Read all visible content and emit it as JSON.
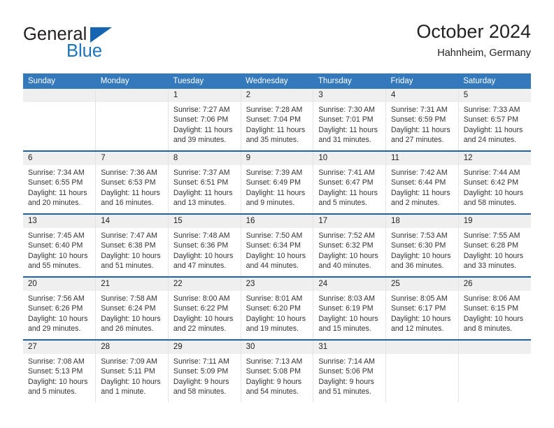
{
  "brand": {
    "name_top": "General",
    "name_bottom": "Blue",
    "triangle_color": "#1665b0",
    "text_top_color": "#231f20",
    "text_bottom_color": "#1c75bc"
  },
  "header": {
    "title": "October 2024",
    "subtitle": "Hahnheim, Germany"
  },
  "theme": {
    "header_row_bg": "#3579bd",
    "header_row_text": "#ffffff",
    "row_separator": "#1f62ab",
    "daynum_band_bg": "#efefef",
    "cell_divider": "#e3e3e3",
    "body_text": "#333333"
  },
  "weekdays": [
    "Sunday",
    "Monday",
    "Tuesday",
    "Wednesday",
    "Thursday",
    "Friday",
    "Saturday"
  ],
  "weeks": [
    [
      {
        "day": "",
        "lines": []
      },
      {
        "day": "",
        "lines": []
      },
      {
        "day": "1",
        "lines": [
          "Sunrise: 7:27 AM",
          "Sunset: 7:06 PM",
          "Daylight: 11 hours",
          "and 39 minutes."
        ]
      },
      {
        "day": "2",
        "lines": [
          "Sunrise: 7:28 AM",
          "Sunset: 7:04 PM",
          "Daylight: 11 hours",
          "and 35 minutes."
        ]
      },
      {
        "day": "3",
        "lines": [
          "Sunrise: 7:30 AM",
          "Sunset: 7:01 PM",
          "Daylight: 11 hours",
          "and 31 minutes."
        ]
      },
      {
        "day": "4",
        "lines": [
          "Sunrise: 7:31 AM",
          "Sunset: 6:59 PM",
          "Daylight: 11 hours",
          "and 27 minutes."
        ]
      },
      {
        "day": "5",
        "lines": [
          "Sunrise: 7:33 AM",
          "Sunset: 6:57 PM",
          "Daylight: 11 hours",
          "and 24 minutes."
        ]
      }
    ],
    [
      {
        "day": "6",
        "lines": [
          "Sunrise: 7:34 AM",
          "Sunset: 6:55 PM",
          "Daylight: 11 hours",
          "and 20 minutes."
        ]
      },
      {
        "day": "7",
        "lines": [
          "Sunrise: 7:36 AM",
          "Sunset: 6:53 PM",
          "Daylight: 11 hours",
          "and 16 minutes."
        ]
      },
      {
        "day": "8",
        "lines": [
          "Sunrise: 7:37 AM",
          "Sunset: 6:51 PM",
          "Daylight: 11 hours",
          "and 13 minutes."
        ]
      },
      {
        "day": "9",
        "lines": [
          "Sunrise: 7:39 AM",
          "Sunset: 6:49 PM",
          "Daylight: 11 hours",
          "and 9 minutes."
        ]
      },
      {
        "day": "10",
        "lines": [
          "Sunrise: 7:41 AM",
          "Sunset: 6:47 PM",
          "Daylight: 11 hours",
          "and 5 minutes."
        ]
      },
      {
        "day": "11",
        "lines": [
          "Sunrise: 7:42 AM",
          "Sunset: 6:44 PM",
          "Daylight: 11 hours",
          "and 2 minutes."
        ]
      },
      {
        "day": "12",
        "lines": [
          "Sunrise: 7:44 AM",
          "Sunset: 6:42 PM",
          "Daylight: 10 hours",
          "and 58 minutes."
        ]
      }
    ],
    [
      {
        "day": "13",
        "lines": [
          "Sunrise: 7:45 AM",
          "Sunset: 6:40 PM",
          "Daylight: 10 hours",
          "and 55 minutes."
        ]
      },
      {
        "day": "14",
        "lines": [
          "Sunrise: 7:47 AM",
          "Sunset: 6:38 PM",
          "Daylight: 10 hours",
          "and 51 minutes."
        ]
      },
      {
        "day": "15",
        "lines": [
          "Sunrise: 7:48 AM",
          "Sunset: 6:36 PM",
          "Daylight: 10 hours",
          "and 47 minutes."
        ]
      },
      {
        "day": "16",
        "lines": [
          "Sunrise: 7:50 AM",
          "Sunset: 6:34 PM",
          "Daylight: 10 hours",
          "and 44 minutes."
        ]
      },
      {
        "day": "17",
        "lines": [
          "Sunrise: 7:52 AM",
          "Sunset: 6:32 PM",
          "Daylight: 10 hours",
          "and 40 minutes."
        ]
      },
      {
        "day": "18",
        "lines": [
          "Sunrise: 7:53 AM",
          "Sunset: 6:30 PM",
          "Daylight: 10 hours",
          "and 36 minutes."
        ]
      },
      {
        "day": "19",
        "lines": [
          "Sunrise: 7:55 AM",
          "Sunset: 6:28 PM",
          "Daylight: 10 hours",
          "and 33 minutes."
        ]
      }
    ],
    [
      {
        "day": "20",
        "lines": [
          "Sunrise: 7:56 AM",
          "Sunset: 6:26 PM",
          "Daylight: 10 hours",
          "and 29 minutes."
        ]
      },
      {
        "day": "21",
        "lines": [
          "Sunrise: 7:58 AM",
          "Sunset: 6:24 PM",
          "Daylight: 10 hours",
          "and 26 minutes."
        ]
      },
      {
        "day": "22",
        "lines": [
          "Sunrise: 8:00 AM",
          "Sunset: 6:22 PM",
          "Daylight: 10 hours",
          "and 22 minutes."
        ]
      },
      {
        "day": "23",
        "lines": [
          "Sunrise: 8:01 AM",
          "Sunset: 6:20 PM",
          "Daylight: 10 hours",
          "and 19 minutes."
        ]
      },
      {
        "day": "24",
        "lines": [
          "Sunrise: 8:03 AM",
          "Sunset: 6:19 PM",
          "Daylight: 10 hours",
          "and 15 minutes."
        ]
      },
      {
        "day": "25",
        "lines": [
          "Sunrise: 8:05 AM",
          "Sunset: 6:17 PM",
          "Daylight: 10 hours",
          "and 12 minutes."
        ]
      },
      {
        "day": "26",
        "lines": [
          "Sunrise: 8:06 AM",
          "Sunset: 6:15 PM",
          "Daylight: 10 hours",
          "and 8 minutes."
        ]
      }
    ],
    [
      {
        "day": "27",
        "lines": [
          "Sunrise: 7:08 AM",
          "Sunset: 5:13 PM",
          "Daylight: 10 hours",
          "and 5 minutes."
        ]
      },
      {
        "day": "28",
        "lines": [
          "Sunrise: 7:09 AM",
          "Sunset: 5:11 PM",
          "Daylight: 10 hours",
          "and 1 minute."
        ]
      },
      {
        "day": "29",
        "lines": [
          "Sunrise: 7:11 AM",
          "Sunset: 5:09 PM",
          "Daylight: 9 hours",
          "and 58 minutes."
        ]
      },
      {
        "day": "30",
        "lines": [
          "Sunrise: 7:13 AM",
          "Sunset: 5:08 PM",
          "Daylight: 9 hours",
          "and 54 minutes."
        ]
      },
      {
        "day": "31",
        "lines": [
          "Sunrise: 7:14 AM",
          "Sunset: 5:06 PM",
          "Daylight: 9 hours",
          "and 51 minutes."
        ]
      },
      {
        "day": "",
        "lines": []
      },
      {
        "day": "",
        "lines": []
      }
    ]
  ]
}
